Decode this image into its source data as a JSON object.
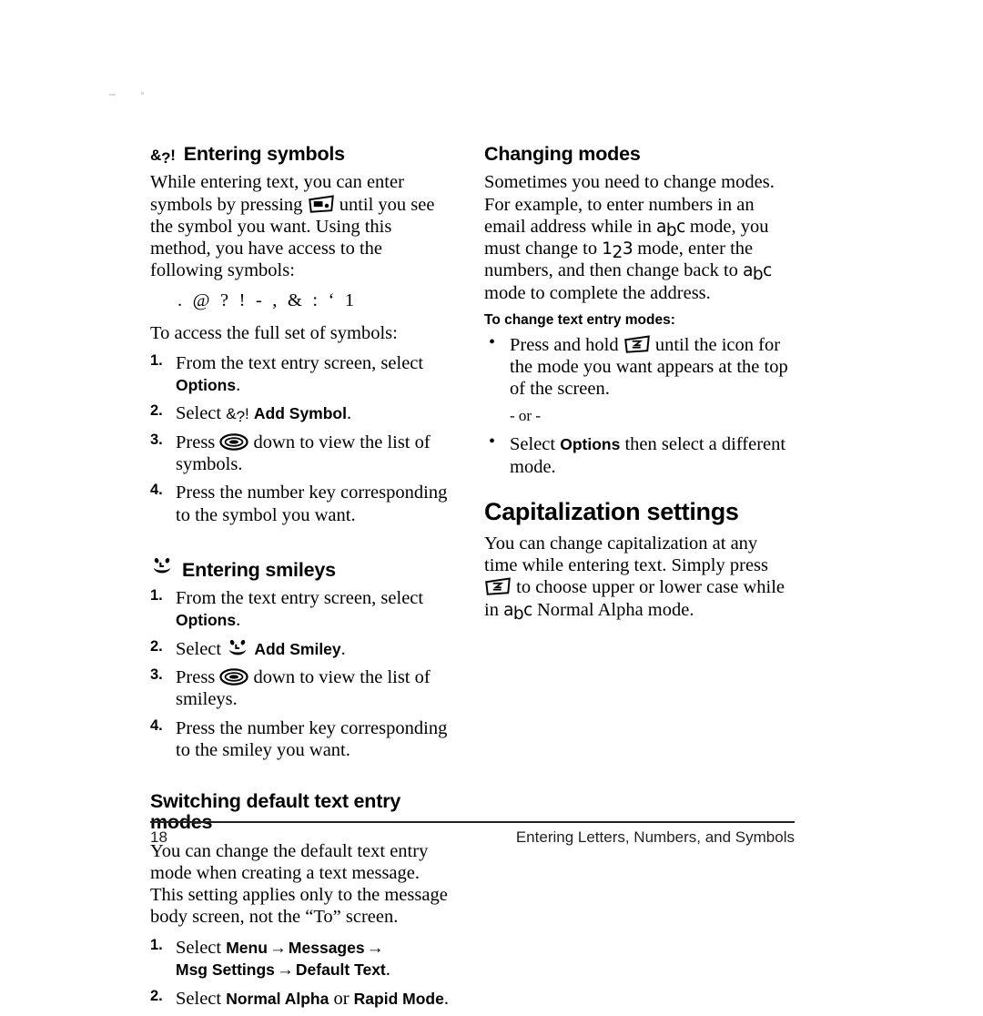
{
  "document": {
    "page_number": "18",
    "footer_title": "Entering Letters, Numbers, and Symbols"
  },
  "left_column": {
    "symbols_section": {
      "icon": "symbol-amp-question-bang-icon",
      "heading": "Entering symbols",
      "intro_part1": "While entering text, you can enter symbols by pressing",
      "intro_icon": "text-mode-key-icon",
      "intro_part2": "until you see the symbol you want. Using this method, you have access to the following symbols:",
      "symbol_list": [
        ".",
        "@",
        "?",
        "!",
        "-",
        ",",
        "&",
        ":",
        "‘",
        "1"
      ],
      "access_lead": "To access the full set of symbols:",
      "steps": [
        {
          "num": "1.",
          "text_before": "From the text entry screen, select ",
          "bold": "Options",
          "text_after": "."
        },
        {
          "num": "2.",
          "text_before": "Select ",
          "inline_icon": "symbol-amp-question-bang-icon",
          "bold": "Add Symbol",
          "text_after": "."
        },
        {
          "num": "3.",
          "text_before": "Press ",
          "inline_icon": "navigation-key-icon",
          "text_after": "down to view the list of symbols."
        },
        {
          "num": "4.",
          "text_before": "Press the number key corresponding to the symbol you want.",
          "text_after": ""
        }
      ]
    },
    "smileys_section": {
      "icon": "smiley-face-icon",
      "heading": "Entering smileys",
      "steps": [
        {
          "num": "1.",
          "text_before": "From the text entry screen, select ",
          "bold": "Options",
          "text_after": "."
        },
        {
          "num": "2.",
          "text_before": "Select ",
          "inline_icon": "smiley-face-icon",
          "bold": "Add Smiley",
          "text_after": "."
        },
        {
          "num": "3.",
          "text_before": "Press ",
          "inline_icon": "navigation-key-icon",
          "text_after": "down to view the list of smileys."
        },
        {
          "num": "4.",
          "text_before": "Press the number key corresponding to the smiley you want.",
          "text_after": ""
        }
      ]
    },
    "switching_section": {
      "heading": "Switching default text entry modes",
      "paragraph": "You can change the default text entry mode when creating a text message. This setting applies only to the message body screen, not the “To” screen.",
      "steps": [
        {
          "num": "1.",
          "lead": "Select ",
          "path": [
            "Menu",
            "Messages",
            "Msg Settings",
            "Default Text"
          ],
          "arrow": "→",
          "period": "."
        },
        {
          "num": "2.",
          "lead": "Select ",
          "option_a": "Normal Alpha",
          "conjunction": " or ",
          "option_b": "Rapid Mode",
          "period": "."
        }
      ]
    }
  },
  "right_column": {
    "changing_modes_section": {
      "heading": "Changing modes",
      "para_part1": "Sometimes you need to change modes. For example, to enter numbers in an email address while in",
      "glyph_abc": "abc",
      "para_part2": "mode, you must change to",
      "glyph_123": "123",
      "para_part3": "mode, enter the numbers, and then change back to",
      "glyph_abc2": "abc",
      "para_part4": "mode to complete the address.",
      "subhead": "To change text entry modes:",
      "bullets": [
        {
          "text_before": "Press and hold ",
          "inline_icon": "text-mode-key-icon",
          "text_after": "until the icon for the mode you want appears at the top of the screen."
        }
      ],
      "or_separator": "- or -",
      "bullet_last": {
        "text_before": "Select ",
        "bold": "Options",
        "text_after": " then select a different mode."
      }
    },
    "capitalization_section": {
      "heading": "Capitalization settings",
      "para_part1": "You can change capitalization at any time while entering text. Simply press",
      "inline_icon": "text-mode-key-icon",
      "para_part2": "to choose upper or lower case while in",
      "glyph_abc": "abc",
      "para_part3": "Normal Alpha mode."
    }
  },
  "colors": {
    "text": "#000000",
    "rule": "#231f20",
    "background": "#ffffff"
  }
}
